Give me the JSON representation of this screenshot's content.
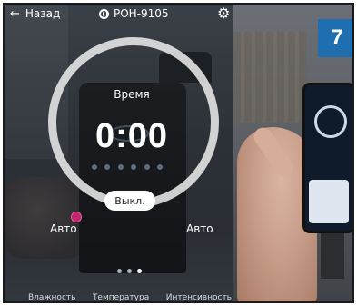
{
  "header": {
    "back_label": "Назад",
    "device_name": "РОН-9105"
  },
  "timer": {
    "label": "Время",
    "value": "0:00",
    "off_button_label": "Выкл."
  },
  "modes": {
    "left": "Авто",
    "right": "Авто"
  },
  "pager": {
    "total": 3,
    "active_index": 2
  },
  "tabs": [
    "Влажность",
    "Температура",
    "Интенсивность"
  ],
  "badge": "7",
  "colors": {
    "knob": "#c2246f",
    "badge": "#1f6fb0"
  }
}
